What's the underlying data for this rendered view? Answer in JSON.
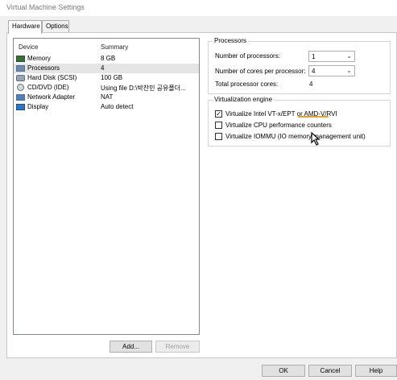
{
  "window": {
    "title": "Virtual Machine Settings"
  },
  "tabs": [
    {
      "label": "Hardware"
    },
    {
      "label": "Options"
    }
  ],
  "device_list": {
    "columns": {
      "device": "Device",
      "summary": "Summary"
    },
    "rows": [
      {
        "name": "Memory",
        "summary": "8 GB",
        "icon": "memory-icon"
      },
      {
        "name": "Processors",
        "summary": "4",
        "icon": "processor-icon"
      },
      {
        "name": "Hard Disk (SCSI)",
        "summary": "100 GB",
        "icon": "hard-disk-icon"
      },
      {
        "name": "CD/DVD (IDE)",
        "summary": "Using file D:\\박찬민 공유폴더...",
        "icon": "cd-dvd-icon"
      },
      {
        "name": "Network Adapter",
        "summary": "NAT",
        "icon": "network-adapter-icon"
      },
      {
        "name": "Display",
        "summary": "Auto detect",
        "icon": "display-icon"
      }
    ],
    "add_label": "Add...",
    "remove_label": "Remove"
  },
  "processors": {
    "group_label": "Processors",
    "num_processors_label": "Number of processors:",
    "num_processors_value": "1",
    "cores_label": "Number of cores per processor:",
    "cores_value": "4",
    "total_label": "Total processor cores:",
    "total_value": "4"
  },
  "virtualization": {
    "group_label": "Virtualization engine",
    "options": [
      {
        "label": "Virtualize Intel VT-x/EPT or AMD-V/RVI",
        "checked": true
      },
      {
        "label": "Virtualize CPU performance counters",
        "checked": false
      },
      {
        "label": "Virtualize IOMMU (IO memory management unit)",
        "checked": false
      }
    ]
  },
  "footer": {
    "ok_label": "OK",
    "cancel_label": "Cancel",
    "help_label": "Help"
  }
}
